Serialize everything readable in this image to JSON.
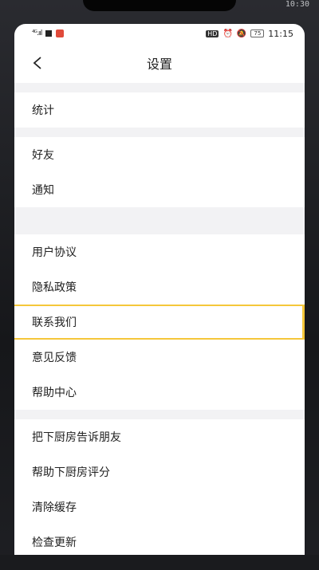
{
  "status_bar": {
    "signal": "⁴ᴳ.ııl",
    "hd": "HD",
    "alarm_icon": "alarm-icon",
    "mute_icon": "bell-off-icon",
    "battery": "75",
    "time": "11:15"
  },
  "bezel_time": "10:30",
  "header": {
    "title": "设置"
  },
  "groups": [
    {
      "items": [
        {
          "label": "统计"
        }
      ]
    },
    {
      "items": [
        {
          "label": "好友"
        },
        {
          "label": "通知"
        }
      ]
    },
    {
      "items": [
        {
          "label": "用户协议"
        },
        {
          "label": "隐私政策"
        },
        {
          "label": "联系我们"
        },
        {
          "label": "意见反馈"
        },
        {
          "label": "帮助中心"
        }
      ]
    },
    {
      "items": [
        {
          "label": "把下厨房告诉朋友"
        },
        {
          "label": "帮助下厨房评分"
        },
        {
          "label": "清除缓存"
        },
        {
          "label": "检查更新"
        }
      ]
    }
  ],
  "colors": {
    "highlight": "#f5c73a",
    "separator": "#f2f2f4"
  }
}
